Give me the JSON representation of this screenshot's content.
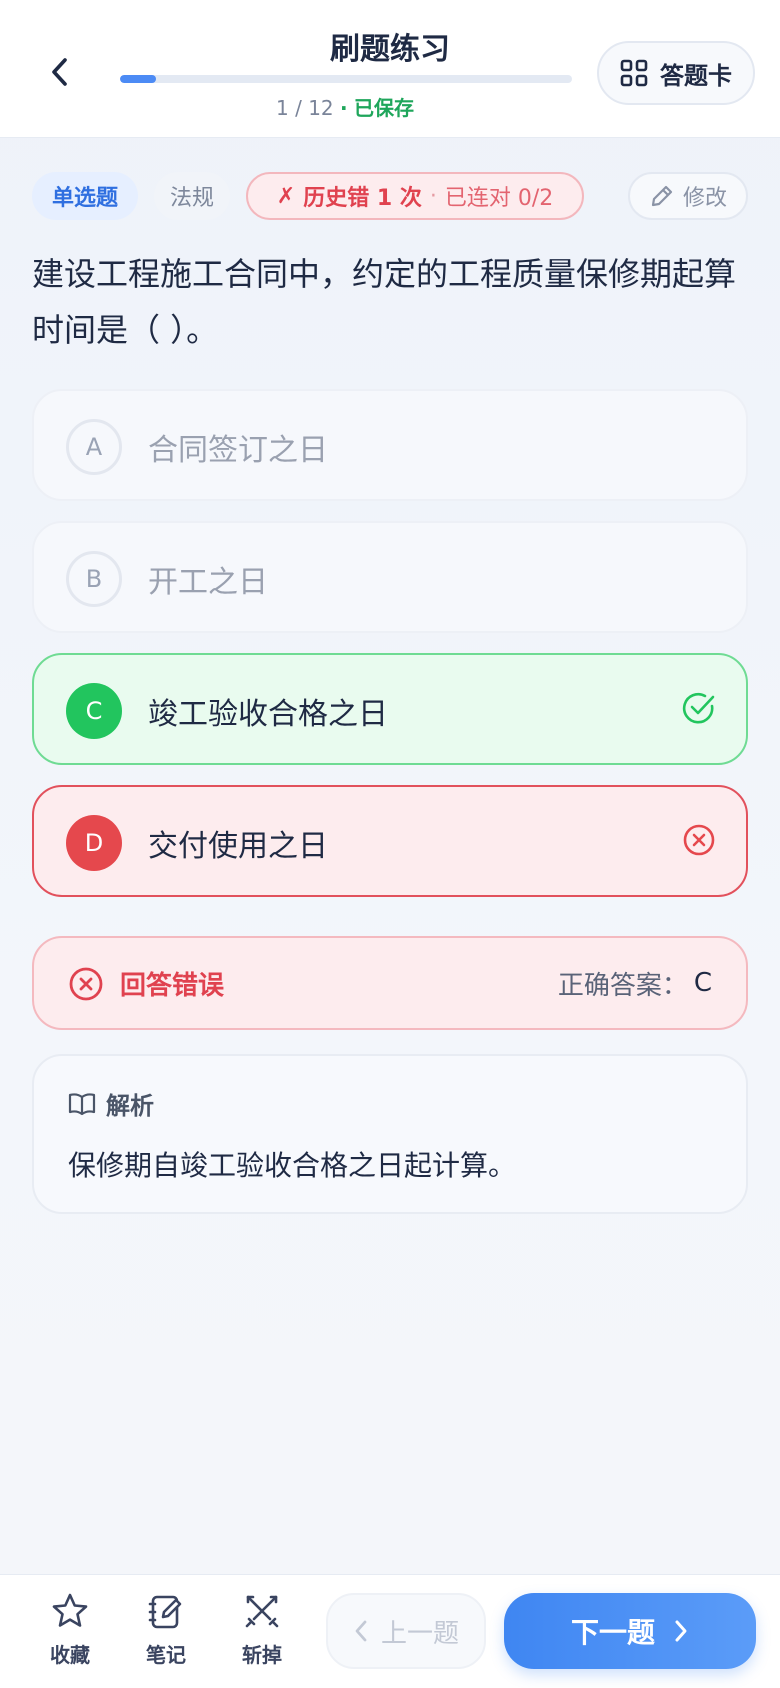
{
  "header": {
    "title": "刷题练习",
    "progress": {
      "current": 1,
      "total": 12,
      "fraction": 0.08,
      "label": "1 / 12",
      "separator": "·",
      "saved_label": "已保存"
    },
    "card_button_label": "答题卡"
  },
  "tags": {
    "type": "单选题",
    "category": "法规",
    "history_mark": "✗",
    "history_count": "历史错 1 次",
    "history_dot": "·",
    "history_streak": "已连对 0/2"
  },
  "edit_label": "修改",
  "question": "建设工程施工合同中，约定的工程质量保修期起算时间是（ ）。",
  "options": [
    {
      "letter": "A",
      "text": "合同签订之日",
      "state": "neutral"
    },
    {
      "letter": "B",
      "text": "开工之日",
      "state": "neutral"
    },
    {
      "letter": "C",
      "text": "竣工验收合格之日",
      "state": "correct"
    },
    {
      "letter": "D",
      "text": "交付使用之日",
      "state": "wrong"
    }
  ],
  "result": {
    "text": "回答错误",
    "answer_prefix": "正确答案：",
    "answer_letter": "C"
  },
  "analysis": {
    "title": "解析",
    "body": "保修期自竣工验收合格之日起计算。"
  },
  "bottom": {
    "favorite": "收藏",
    "notes": "笔记",
    "eliminate": "斩掉",
    "prev": "上一题",
    "next": "下一题"
  },
  "colors": {
    "accent": "#4c8bf5",
    "correct": "#22c55e",
    "wrong": "#e5484d",
    "saved": "#1fa65b"
  },
  "icons": {
    "back": "chevron-left-icon",
    "card": "grid-icon",
    "edit": "pencil-icon",
    "correct": "check-circle-icon",
    "wrong": "x-circle-icon",
    "analysis": "book-open-icon",
    "favorite": "star-icon",
    "notes": "notebook-pen-icon",
    "eliminate": "swords-icon",
    "prev": "chevron-left-icon",
    "next": "chevron-right-icon"
  }
}
